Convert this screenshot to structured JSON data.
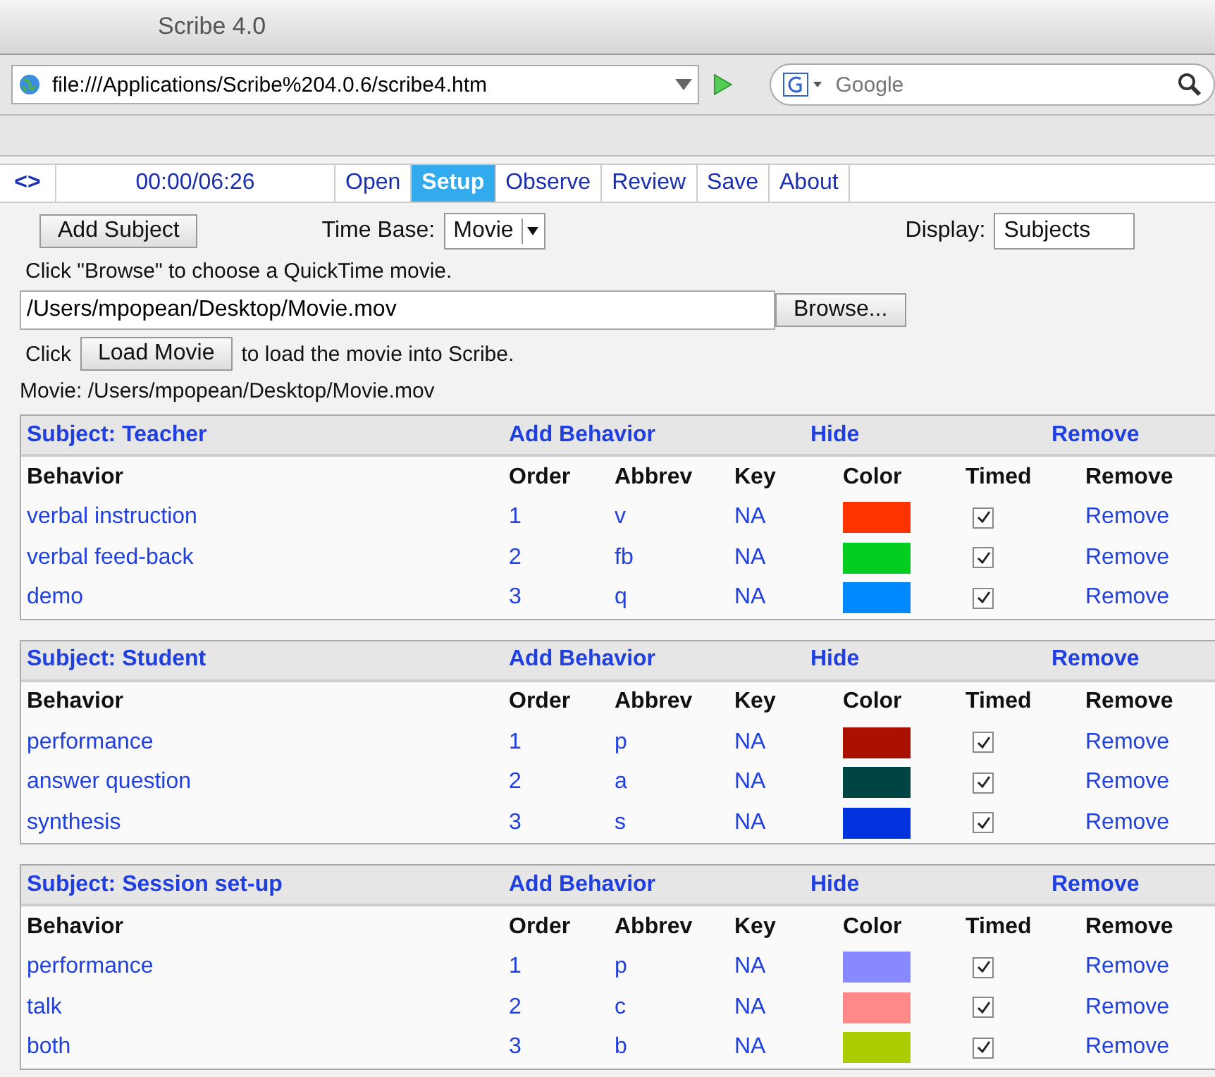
{
  "window": {
    "title": "Scribe 4.0"
  },
  "browser": {
    "url": "file:///Applications/Scribe%204.0.6/scribe4.htm",
    "search_placeholder": "Google"
  },
  "nav": {
    "toggle": "<>",
    "time": "00:00/06:26",
    "tabs": [
      {
        "label": "Open",
        "selected": false
      },
      {
        "label": "Setup",
        "selected": true
      },
      {
        "label": "Observe",
        "selected": false
      },
      {
        "label": "Review",
        "selected": false
      },
      {
        "label": "Save",
        "selected": false
      },
      {
        "label": "About",
        "selected": false
      }
    ]
  },
  "setup": {
    "add_subject": "Add Subject",
    "time_base_label": "Time Base:",
    "time_base": "Movie",
    "display_label": "Display:",
    "display": "Subjects",
    "browse_hint": "Click \"Browse\" to choose a QuickTime movie.",
    "file_path": "/Users/mpopean/Desktop/Movie.mov",
    "browse": "Browse...",
    "load_prefix": "Click",
    "load_button": "Load Movie",
    "load_suffix": "to load the movie into Scribe.",
    "movie_status": "Movie: /Users/mpopean/Desktop/Movie.mov"
  },
  "subjects": [
    {
      "title": "Subject: Teacher",
      "add_behavior": "Add Behavior",
      "hide": "Hide",
      "remove": "Remove",
      "columns": [
        "Behavior",
        "Order",
        "Abbrev",
        "Key",
        "Color",
        "Timed",
        "Remove"
      ],
      "rows": [
        {
          "behavior": "verbal instruction",
          "order": "1",
          "abbrev": "v",
          "key": "NA",
          "color": "#ff3300",
          "timed": true,
          "remove": "Remove"
        },
        {
          "behavior": "verbal feed-back",
          "order": "2",
          "abbrev": "fb",
          "key": "NA",
          "color": "#00cc22",
          "timed": true,
          "remove": "Remove"
        },
        {
          "behavior": "demo",
          "order": "3",
          "abbrev": "q",
          "key": "NA",
          "color": "#0088ff",
          "timed": true,
          "remove": "Remove"
        }
      ]
    },
    {
      "title": "Subject: Student",
      "add_behavior": "Add Behavior",
      "hide": "Hide",
      "remove": "Remove",
      "columns": [
        "Behavior",
        "Order",
        "Abbrev",
        "Key",
        "Color",
        "Timed",
        "Remove"
      ],
      "rows": [
        {
          "behavior": "performance",
          "order": "1",
          "abbrev": "p",
          "key": "NA",
          "color": "#aa1100",
          "timed": true,
          "remove": "Remove"
        },
        {
          "behavior": "answer question",
          "order": "2",
          "abbrev": "a",
          "key": "NA",
          "color": "#004444",
          "timed": true,
          "remove": "Remove"
        },
        {
          "behavior": "synthesis",
          "order": "3",
          "abbrev": "s",
          "key": "NA",
          "color": "#0033dd",
          "timed": true,
          "remove": "Remove"
        }
      ]
    },
    {
      "title": "Subject: Session set-up",
      "add_behavior": "Add Behavior",
      "hide": "Hide",
      "remove": "Remove",
      "columns": [
        "Behavior",
        "Order",
        "Abbrev",
        "Key",
        "Color",
        "Timed",
        "Remove"
      ],
      "rows": [
        {
          "behavior": "performance",
          "order": "1",
          "abbrev": "p",
          "key": "NA",
          "color": "#8888ff",
          "timed": true,
          "remove": "Remove"
        },
        {
          "behavior": "talk",
          "order": "2",
          "abbrev": "c",
          "key": "NA",
          "color": "#ff8888",
          "timed": true,
          "remove": "Remove"
        },
        {
          "behavior": "both",
          "order": "3",
          "abbrev": "b",
          "key": "NA",
          "color": "#aacc00",
          "timed": true,
          "remove": "Remove"
        }
      ]
    }
  ]
}
